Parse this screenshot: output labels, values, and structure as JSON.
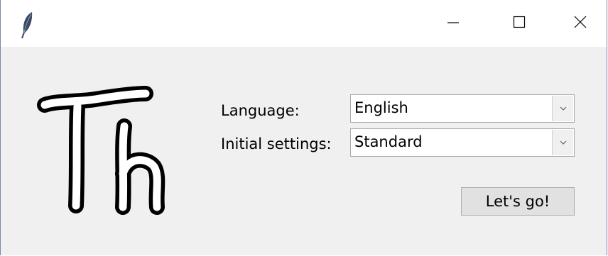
{
  "window": {
    "app_icon": "feather-icon",
    "controls": {
      "minimize_icon": "minimize-icon",
      "maximize_icon": "maximize-icon",
      "close_icon": "close-icon"
    }
  },
  "logo": {
    "icon": "th-logo-icon",
    "text": "Th"
  },
  "form": {
    "language_label": "Language:",
    "language_value": "English",
    "initial_settings_label": "Initial settings:",
    "initial_settings_value": "Standard"
  },
  "actions": {
    "go_label": "Let's go!"
  },
  "colors": {
    "background": "#f0f0f0",
    "titlebar": "#ffffff",
    "button_face": "#e1e1e1",
    "border": "#adadad"
  }
}
